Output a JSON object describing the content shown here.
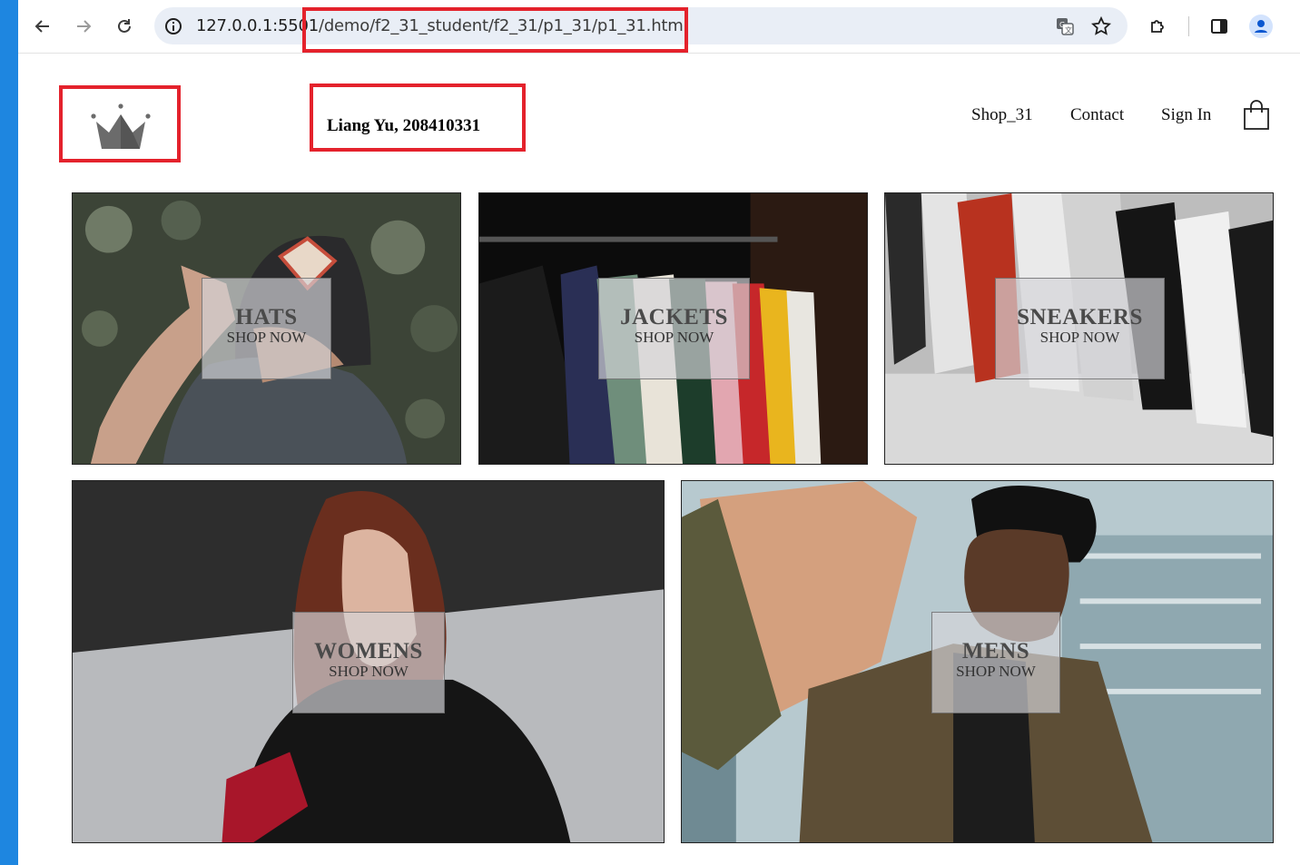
{
  "browser": {
    "host": "127.0.0.1:5501",
    "path": "/demo/f2_31_student/f2_31/p1_31/p1_31.html"
  },
  "header": {
    "student_label": "Liang Yu, 208410331",
    "nav": [
      "Shop_31",
      "Contact",
      "Sign In"
    ]
  },
  "tiles": [
    {
      "category": "HATS",
      "cta": "SHOP NOW"
    },
    {
      "category": "JACKETS",
      "cta": "SHOP NOW"
    },
    {
      "category": "SNEAKERS",
      "cta": "SHOP NOW"
    },
    {
      "category": "WOMENS",
      "cta": "SHOP NOW"
    },
    {
      "category": "MENS",
      "cta": "SHOP NOW"
    }
  ],
  "colors": {
    "annotation_red": "#e4222c",
    "omnibox_bg": "#e9eef6",
    "logo_gray": "#6b6b6b"
  }
}
